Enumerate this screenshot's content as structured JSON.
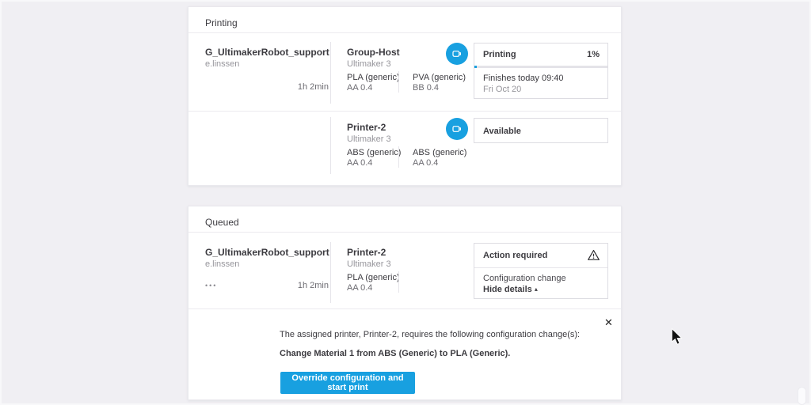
{
  "colors": {
    "accent": "#18a0e0",
    "page_bg": "#f0eff3"
  },
  "printing": {
    "title": "Printing",
    "job": {
      "name": "G_UltimakerRobot_support",
      "owner": "e.linssen",
      "duration": "1h 2min",
      "printer_name": "Group-Host",
      "printer_model": "Ultimaker 3",
      "material_1": "PLA (generic)",
      "core_1": "AA 0.4",
      "material_2": "PVA (generic)",
      "core_2": "BB 0.4",
      "status_label": "Printing",
      "progress_label": "1%",
      "progress_pct": 1,
      "finish_line": "Finishes today 09:40",
      "finish_date": "Fri Oct 20"
    },
    "idle_printer": {
      "printer_name": "Printer-2",
      "printer_model": "Ultimaker 3",
      "material_1": "ABS (generic)",
      "core_1": "AA 0.4",
      "material_2": "ABS (generic)",
      "core_2": "AA 0.4",
      "status_label": "Available"
    }
  },
  "queued": {
    "title": "Queued",
    "job": {
      "name": "G_UltimakerRobot_support",
      "owner": "e.linssen",
      "menu_glyph": "•••",
      "duration": "1h 2min",
      "printer_name": "Printer-2",
      "printer_model": "Ultimaker 3",
      "material_1": "PLA (generic)",
      "core_1": "AA 0.4",
      "status_label": "Action required",
      "status_line": "Configuration change",
      "toggle_label": "Hide details",
      "toggle_caret": "▴"
    },
    "details": {
      "close_glyph": "✕",
      "message": "The assigned printer, Printer-2, requires the following configuration change(s):",
      "change": "Change Material 1 from ABS (Generic) to PLA (Generic).",
      "button_label": "Override configuration and start print"
    }
  }
}
